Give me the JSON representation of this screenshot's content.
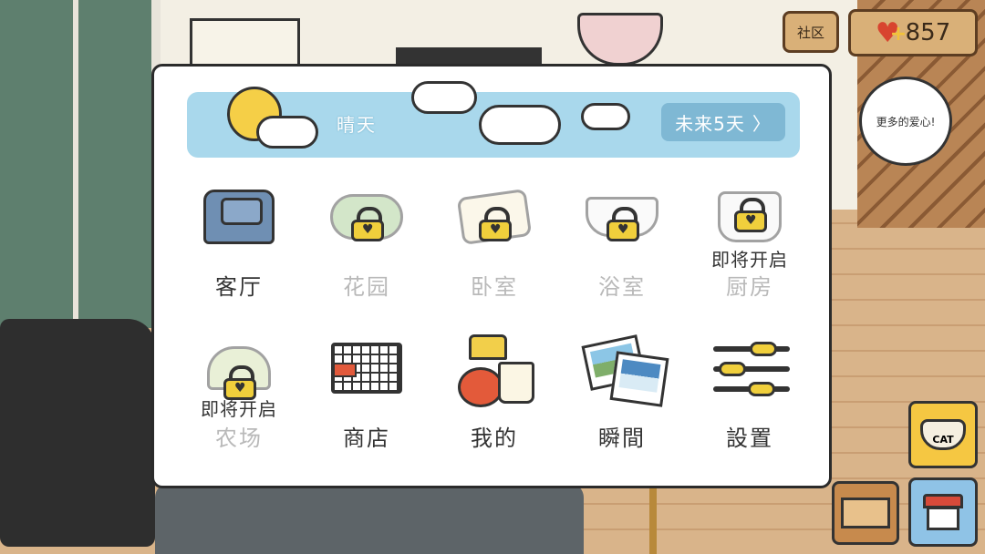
{
  "top_right": {
    "community_label": "社区",
    "hearts_count": "857",
    "bubble_text": "更多的爱心!"
  },
  "weather": {
    "condition": "晴天",
    "forecast_label": "未来5天",
    "forecast_chevron": "〉"
  },
  "menu": {
    "items": [
      {
        "label": "客厅",
        "icon": "armchair-icon",
        "locked": false,
        "soon": ""
      },
      {
        "label": "花园",
        "icon": "garden-icon",
        "locked": true,
        "soon": ""
      },
      {
        "label": "卧室",
        "icon": "pillow-icon",
        "locked": true,
        "soon": ""
      },
      {
        "label": "浴室",
        "icon": "bathtub-icon",
        "locked": true,
        "soon": ""
      },
      {
        "label": "厨房",
        "icon": "cooking-pot-icon",
        "locked": true,
        "soon": "即将开启"
      },
      {
        "label": "农场",
        "icon": "sprout-icon",
        "locked": true,
        "soon": "即将开启"
      },
      {
        "label": "商店",
        "icon": "shopping-cart-icon",
        "locked": false,
        "soon": ""
      },
      {
        "label": "我的",
        "icon": "lamp-tomato-mug-icon",
        "locked": false,
        "soon": ""
      },
      {
        "label": "瞬間",
        "icon": "photos-icon",
        "locked": false,
        "soon": ""
      },
      {
        "label": "設置",
        "icon": "sliders-icon",
        "locked": false,
        "soon": ""
      }
    ]
  },
  "bottom_right": {
    "cat_bowl_text": "CAT"
  },
  "colors": {
    "sky": "#a9d8ec",
    "forecast_button": "#7fb8d4",
    "lock_yellow": "#f0cf3c",
    "heart_red": "#d8442f"
  }
}
